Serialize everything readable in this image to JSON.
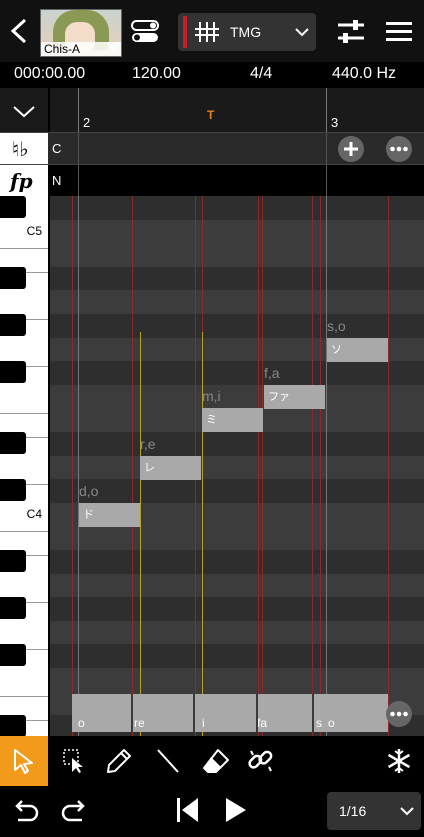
{
  "header": {
    "back_icon": "chevron-left-icon",
    "singer_name": "Chis-A",
    "toggle_icon": "toggle-icon",
    "track_name": "TMG",
    "track_color": "#c81e28",
    "mixer_icon": "sliders-icon",
    "menu_icon": "hamburger-icon"
  },
  "info": {
    "time": "000:00.00",
    "tempo": "120.00",
    "time_signature": "4/4",
    "tuning": "440.0 Hz"
  },
  "ruler": {
    "measure_2": "2",
    "measure_3": "3",
    "tempo_marker": "T",
    "tempo_marker_color": "#e8801a"
  },
  "rows": {
    "chord_label": "C",
    "dynamics_label": "N"
  },
  "keyboard": {
    "c5_label": "C5",
    "c4_label": "C4"
  },
  "notes": [
    {
      "lyric": "d,o",
      "text": "ド"
    },
    {
      "lyric": "r,e",
      "text": "レ"
    },
    {
      "lyric": "m,i",
      "text": "ミ"
    },
    {
      "lyric": "f,a",
      "text": "ファ"
    },
    {
      "lyric": "s,o",
      "text": "ソ"
    }
  ],
  "phonemes": [
    "o",
    "re",
    "i",
    "fa",
    "s",
    "o"
  ],
  "tools": {
    "select": "arrow-cursor-icon",
    "range": "range-select-icon",
    "pencil": "pencil-icon",
    "line": "line-icon",
    "eraser": "eraser-icon",
    "link": "link-icon",
    "freeze": "snowflake-icon",
    "active_color": "#f29a1a"
  },
  "transport": {
    "quantize": "1/16"
  }
}
